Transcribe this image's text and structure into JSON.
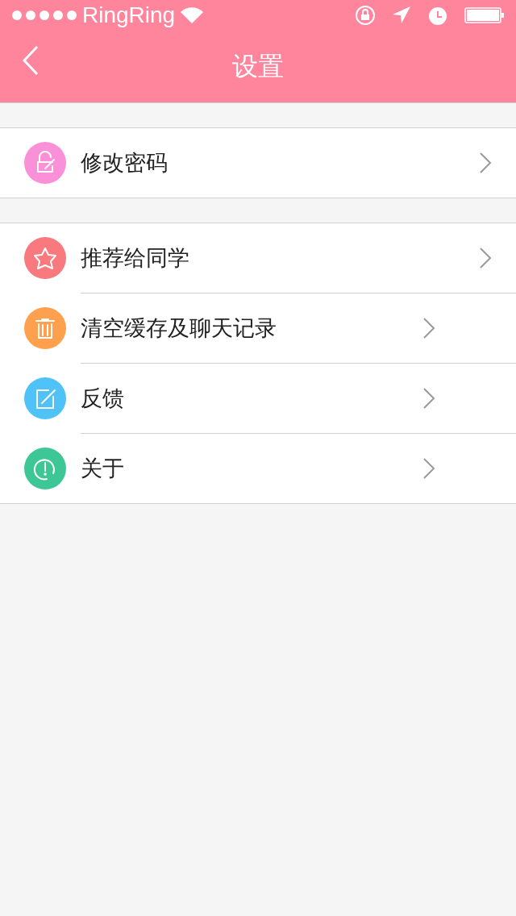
{
  "status_bar": {
    "carrier": "RingRing"
  },
  "nav": {
    "title": "设置"
  },
  "sections": [
    {
      "items": [
        {
          "label": "修改密码",
          "kind": "lock",
          "color": "#f990d8"
        }
      ]
    },
    {
      "items": [
        {
          "label": "推荐给同学",
          "kind": "star",
          "color": "#f8797e"
        },
        {
          "label": "清空缓存及聊天记录",
          "kind": "trash",
          "color": "#ffa04e"
        },
        {
          "label": "反馈",
          "kind": "edit",
          "color": "#4fc3f7"
        },
        {
          "label": "关于",
          "kind": "info",
          "color": "#3ec796"
        }
      ]
    }
  ]
}
